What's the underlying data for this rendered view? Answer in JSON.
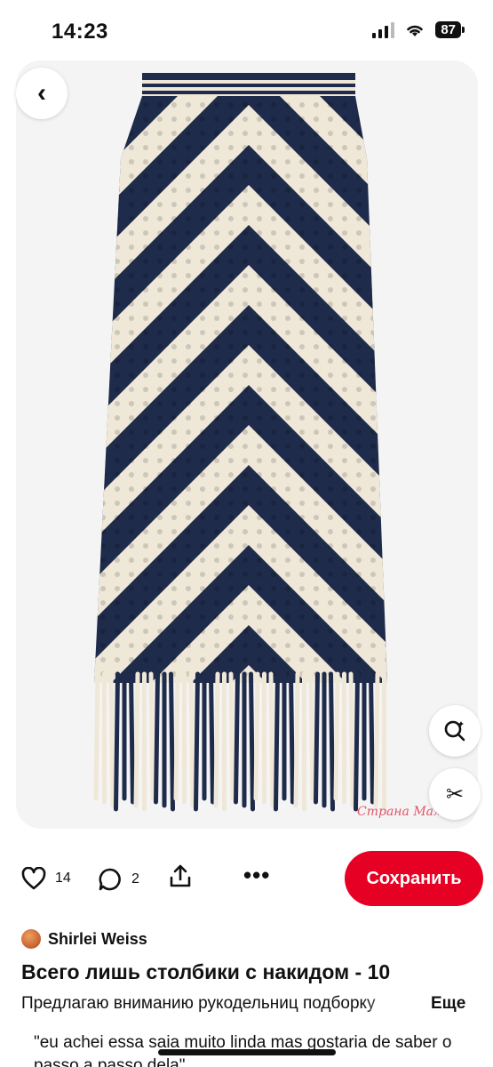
{
  "status_bar": {
    "time": "14:23",
    "battery": "87"
  },
  "image": {
    "watermark": "Страна Мам",
    "colors": {
      "navy": "#1f2b4a",
      "cream": "#efe8d8"
    }
  },
  "icons": {
    "back": "chevron-left-icon",
    "visual_search": "lens-search-icon",
    "cutout": "scissors-icon",
    "like": "heart-icon",
    "comment": "comment-bubble-icon",
    "share": "share-icon",
    "more": "more-options-icon"
  },
  "actions": {
    "likes": "14",
    "comments": "2",
    "more_label": "•••",
    "save_label": "Сохранить"
  },
  "pin": {
    "author": "Shirlei Weiss",
    "title": "Всего лишь столбики с накидом - 10",
    "description": "Предлагаю вниманию рукодельниц подборку",
    "more_link": "Еще",
    "comment": "\"eu achei essa saia muito linda mas gostaria de saber o passo a passo dela\""
  },
  "colors": {
    "save_button": "#e60023"
  }
}
